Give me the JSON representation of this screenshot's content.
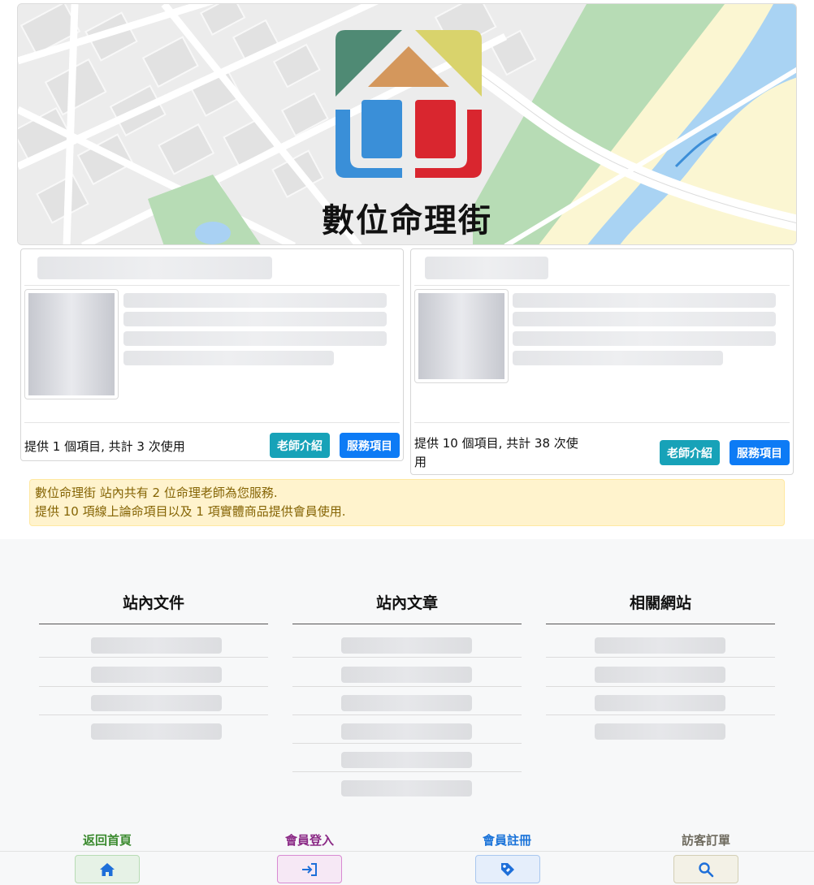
{
  "site": {
    "title": "數位命理街"
  },
  "teachers": [
    {
      "footer_text": "提供 1 個項目, 共計 3 次使用",
      "intro_label": "老師介紹",
      "service_label": "服務項目"
    },
    {
      "footer_text": "提供 10 個項目, 共計 38 次使用",
      "intro_label": "老師介紹",
      "service_label": "服務項目"
    }
  ],
  "notice": {
    "line1": "數位命理街 站內共有 2 位命理老師為您服務.",
    "line2": "提供 10 項線上論命項目以及 1 項實體商品提供會員使用."
  },
  "footer": {
    "columns": [
      {
        "heading": "站內文件",
        "item_count": 4
      },
      {
        "heading": "站內文章",
        "item_count": 6
      },
      {
        "heading": "相關網站",
        "item_count": 4
      }
    ]
  },
  "bottom_nav": [
    {
      "label": "返回首頁",
      "icon": "home-icon",
      "color": "#3a8a2e",
      "bg": "#e6f2e6",
      "border": "#b8dcb4",
      "icon_color": "#1e6fd9"
    },
    {
      "label": "會員登入",
      "icon": "login-icon",
      "color": "#8b2a86",
      "bg": "#f6e8f5",
      "border": "#d88ad2",
      "icon_color": "#1e6fd9"
    },
    {
      "label": "會員註冊",
      "icon": "tag-icon",
      "color": "#1a73d9",
      "bg": "#e5eefb",
      "border": "#a9c7ef",
      "icon_color": "#1e6fd9"
    },
    {
      "label": "訪客訂單",
      "icon": "search-icon",
      "color": "#6e6a5e",
      "bg": "#f3f1e6",
      "border": "#d3cfb5",
      "icon_color": "#1e6fd9"
    }
  ]
}
